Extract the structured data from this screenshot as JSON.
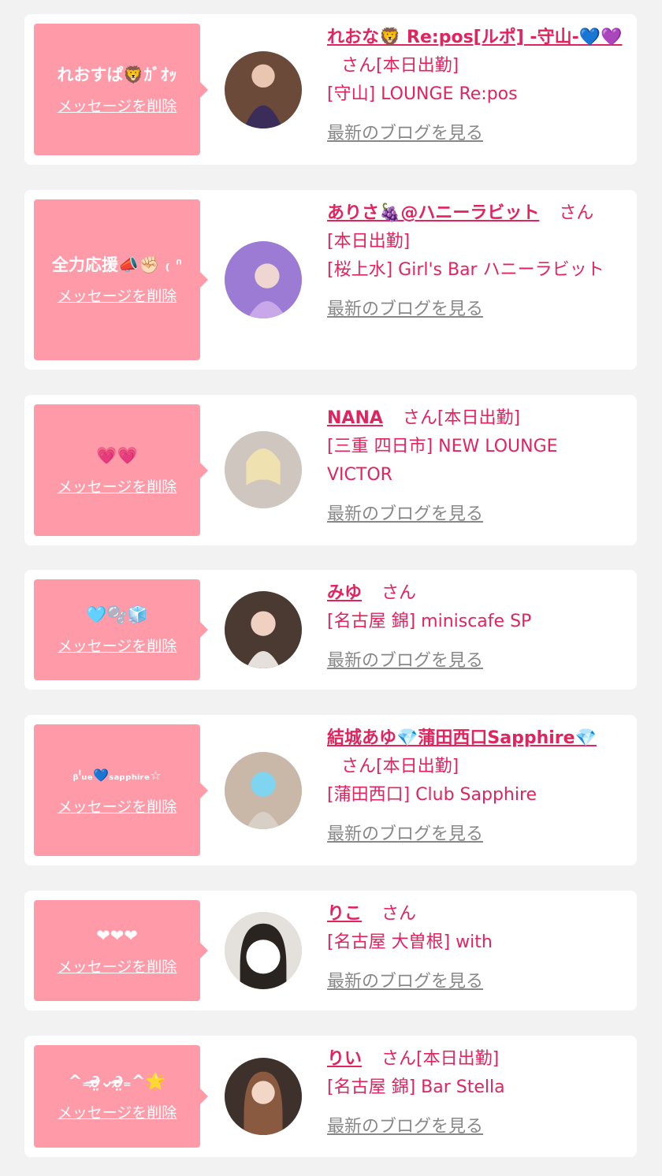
{
  "items": [
    {
      "message": "れおすぱ🦁ｶﾞｵｯ",
      "delete_label": "メッセージを削除",
      "name": "れおな🦁 Re:pos[ルポ] -守山-💙💜",
      "honorific": "さん",
      "status": "[本日出勤]",
      "shop": "[守山] LOUNGE Re:pos",
      "blog_label": "最新のブログを見る"
    },
    {
      "message": "全力応援📣✊🏻 ₍ ᐢ",
      "delete_label": "メッセージを削除",
      "name": "ありさ🍇@ハニーラビット",
      "honorific": "さん",
      "status": "[本日出勤]",
      "shop": "[桜上水] Girl's Bar ハニーラビット",
      "blog_label": "最新のブログを見る"
    },
    {
      "message": "💗💗",
      "delete_label": "メッセージを削除",
      "name": "NANA",
      "honorific": "さん",
      "status": "[本日出勤]",
      "shop": "[三重 四日市] NEW LOUNGE VICTOR",
      "blog_label": "最新のブログを見る"
    },
    {
      "message": "🩵🫧🧊",
      "delete_label": "メッセージを削除",
      "name": "みゆ",
      "honorific": "さん",
      "status": "",
      "shop": "[名古屋 錦] miniscafe SP",
      "blog_label": "最新のブログを見る"
    },
    {
      "message": "ᵦˡᵤₑ💙ₛₐₚₚₕᵢᵣₑ☆",
      "delete_label": "メッセージを削除",
      "name": "結城あゆ💎蒲田西口Sapphire💎",
      "honorific": "さん",
      "status": "[本日出勤]",
      "shop": "[蒲田西口] Club Sapphire",
      "blog_label": "最新のブログを見る"
    },
    {
      "message": "❤❤❤",
      "delete_label": "メッセージを削除",
      "name": "りこ",
      "honorific": "さん",
      "status": "",
      "shop": "[名古屋 大曽根] with",
      "blog_label": "最新のブログを見る"
    },
    {
      "message": "^₌∂̴̶̷̤⌄∂̴̶̷̤₌^🌟",
      "delete_label": "メッセージを削除",
      "name": "りい",
      "honorific": "さん",
      "status": "[本日出勤]",
      "shop": "[名古屋 錦] Bar Stella",
      "blog_label": "最新のブログを見る"
    }
  ],
  "colors": {
    "accent": "#e0245e",
    "bubble": "#ff9aa8",
    "background": "#f2f2f2",
    "muted": "#888888"
  }
}
